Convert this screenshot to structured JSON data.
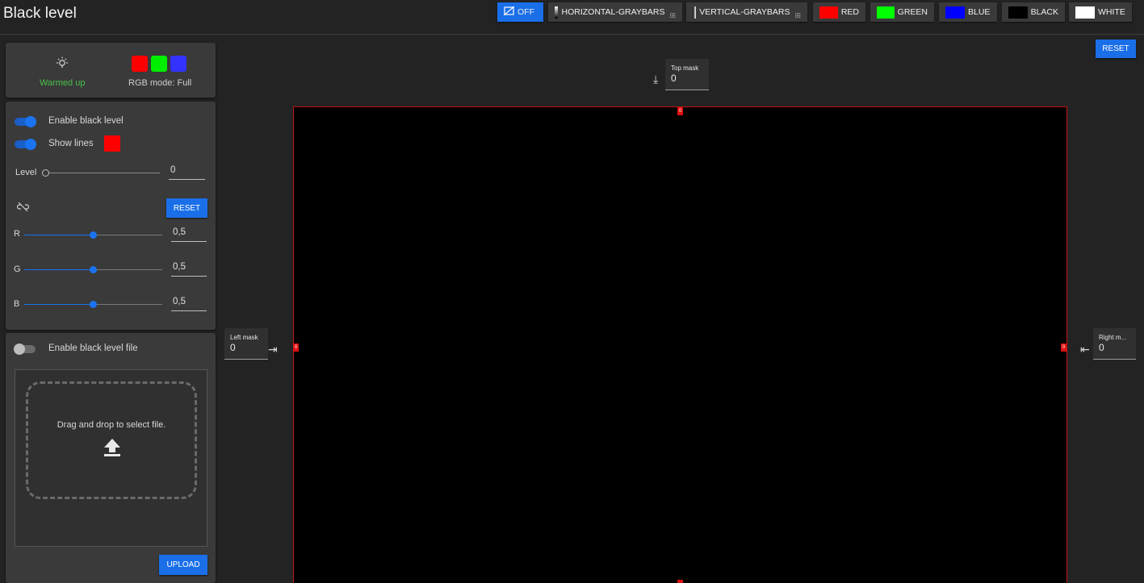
{
  "page": {
    "title": "Black level"
  },
  "toolbar": {
    "off": "OFF",
    "horizontal_graybars": "HORIZONTAL-GRAYBARS",
    "vertical_graybars": "VERTICAL-GRAYBARS",
    "red": "RED",
    "green": "GREEN",
    "blue": "BLUE",
    "black": "BLACK",
    "white": "WHITE",
    "swatch_colors": {
      "red": "#ff0000",
      "green": "#00ff00",
      "blue": "#0000ff",
      "black": "#000000",
      "white": "#ffffff"
    }
  },
  "status": {
    "warm_label": "Warmed up",
    "rgb_mode": "RGB mode: Full",
    "rgb_squares": [
      "#ff0000",
      "#00ee00",
      "#3333ff"
    ]
  },
  "black_level": {
    "enable_label": "Enable black level",
    "enable_on": true,
    "show_lines_label": "Show lines",
    "show_lines_on": true,
    "line_color": "#ff0000",
    "level_label": "Level",
    "level_value": "0",
    "reset_label": "RESET",
    "channels": [
      {
        "label": "R",
        "value": "0,5"
      },
      {
        "label": "G",
        "value": "0,5"
      },
      {
        "label": "B",
        "value": "0,5"
      }
    ]
  },
  "file": {
    "enable_label": "Enable black level file",
    "enable_on": false,
    "drop_text": "Drag and drop to select file.",
    "upload_label": "UPLOAD"
  },
  "preview": {
    "reset_label": "RESET",
    "top_mask": {
      "label": "Top mask",
      "value": "0"
    },
    "left_mask": {
      "label": "Left mask",
      "value": "0"
    },
    "right_mask": {
      "label": "Right m...",
      "value": "0"
    },
    "marker_value": "0",
    "accent_color": "#1a6fe8",
    "line_color": "#c01414"
  }
}
